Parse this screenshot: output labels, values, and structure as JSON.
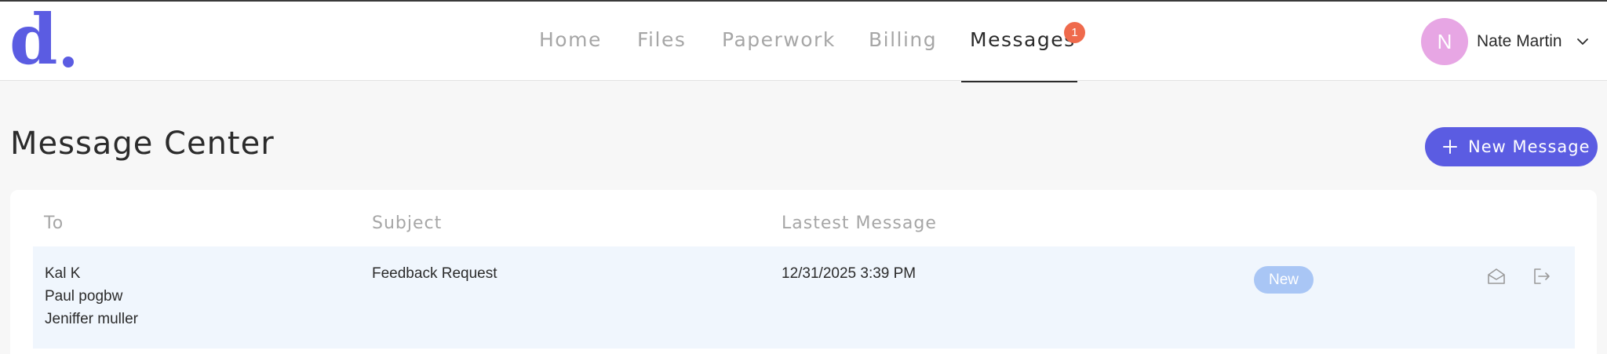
{
  "header": {
    "logo_text": "d",
    "nav": [
      {
        "label": "Home"
      },
      {
        "label": "Files"
      },
      {
        "label": "Paperwork"
      },
      {
        "label": "Billing"
      },
      {
        "label": "Messages",
        "active": true,
        "badge": "1"
      }
    ],
    "user": {
      "initial": "N",
      "name": "Nate Martin"
    }
  },
  "main": {
    "title": "Message Center",
    "new_button_label": "New Message",
    "table": {
      "columns": [
        "To",
        "Subject",
        "Lastest Message"
      ],
      "rows": [
        {
          "to": [
            "Kal K",
            "Paul pogbw",
            "Jeniffer muller"
          ],
          "subject": "Feedback Request",
          "latest": "12/31/2025 3:39 PM",
          "status": "New"
        }
      ]
    }
  },
  "colors": {
    "accent": "#5b5ce2",
    "badge": "#ef6a4c",
    "avatar": "#e7a6e4",
    "row_highlight": "#f0f6fd",
    "status_pill": "#a9c6f5"
  },
  "icons": [
    "chevron-down-icon",
    "plus-icon",
    "open-envelope-icon",
    "exit-icon"
  ]
}
